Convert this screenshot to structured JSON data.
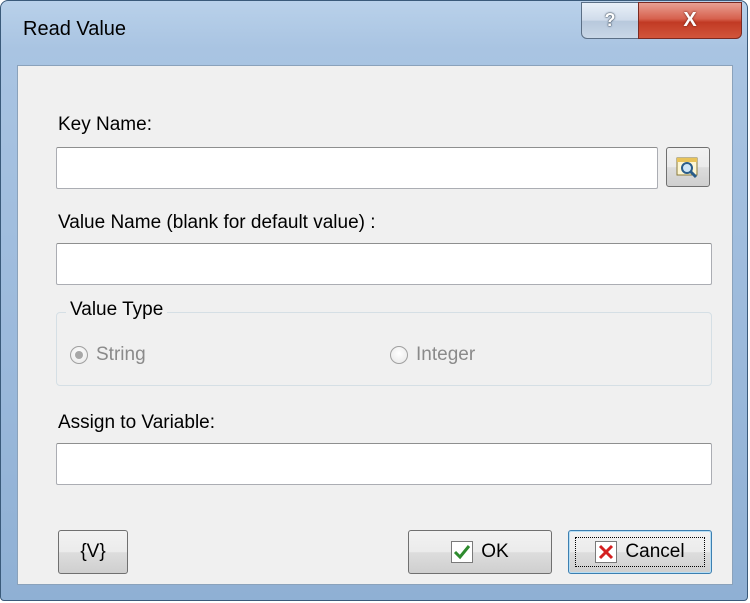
{
  "window": {
    "title": "Read Value",
    "help_glyph": "?",
    "close_glyph": "X",
    "icons": {
      "help": "help-icon",
      "close": "close-icon"
    }
  },
  "form": {
    "key_name": {
      "label": "Key Name:",
      "value": "",
      "browse_icon": "magnifier-browse-icon"
    },
    "value_name": {
      "label": "Value Name (blank for default value) :",
      "value": ""
    },
    "value_type": {
      "group_label": "Value Type",
      "options": [
        {
          "label": "String",
          "selected": true,
          "enabled": false
        },
        {
          "label": "Integer",
          "selected": false,
          "enabled": false
        }
      ]
    },
    "assign_var": {
      "label": "Assign to Variable:",
      "value": ""
    }
  },
  "buttons": {
    "variable_label": "{V}",
    "ok_label": "OK",
    "cancel_label": "Cancel",
    "ok_icon": "checkmark-icon",
    "cancel_icon": "red-x-icon"
  },
  "colors": {
    "check_green": "#2e8b2e",
    "cancel_red": "#d42020",
    "close_red": "#c13a24"
  }
}
